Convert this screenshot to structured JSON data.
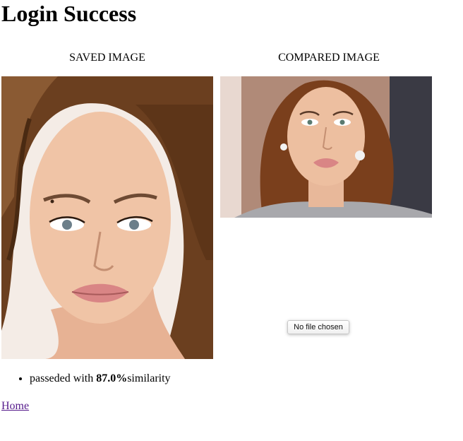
{
  "page": {
    "title": "Login Success"
  },
  "saved": {
    "label": "SAVED IMAGE",
    "photo_name": "portrait-photo"
  },
  "compared": {
    "label": "COMPARED IMAGE",
    "photo_name": "portrait-photo"
  },
  "file_input": {
    "label": "No file chosen"
  },
  "result": {
    "prefix": "passeded with ",
    "value": "87.0%",
    "suffix": "similarity"
  },
  "nav": {
    "home": "Home"
  },
  "colors": {
    "link": "#551a8b",
    "skin": "#e8b89a",
    "hair": "#5a3418",
    "lips": "#d98585"
  }
}
